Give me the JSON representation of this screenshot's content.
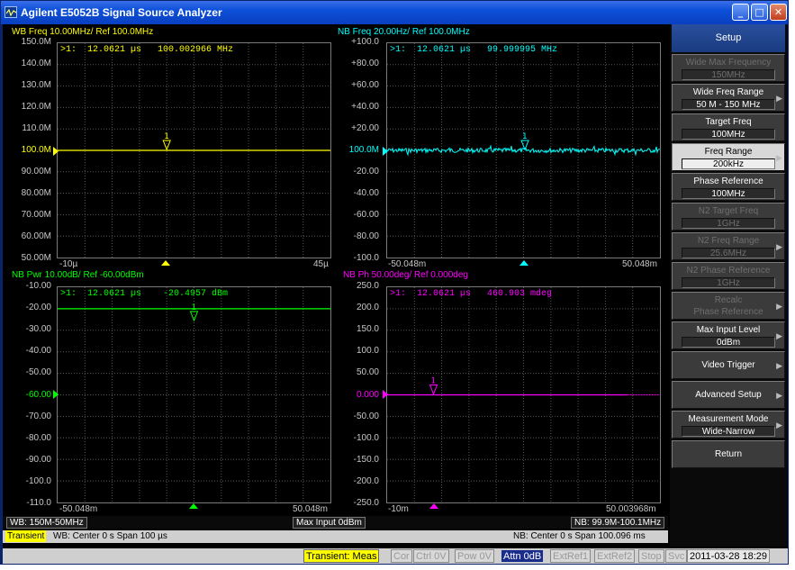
{
  "window": {
    "title": "Agilent E5052B Signal Source Analyzer",
    "min": "_",
    "max": "□",
    "close": "✕"
  },
  "panels": {
    "wb_freq": {
      "title": "WB Freq 10.00MHz/ Ref 100.0MHz",
      "y_labels": [
        "150.0M",
        "140.0M",
        "130.0M",
        "120.0M",
        "110.0M",
        "100.0M",
        "90.00M",
        "80.00M",
        "70.00M",
        "60.00M",
        "50.00M"
      ],
      "marker": ">1:  12.0621 µs   100.002966 MHz",
      "x_start": "-10µ",
      "x_end": "45µ",
      "color": "#ffff00"
    },
    "nb_freq": {
      "title": "NB Freq 20.00Hz/ Ref 100.0MHz",
      "y_labels": [
        "+100.0",
        "+80.00",
        "+60.00",
        "+40.00",
        "+20.00",
        "100.0M",
        "-20.00",
        "-40.00",
        "-60.00",
        "-80.00",
        "-100.0"
      ],
      "marker": ">1:  12.0621 µs   99.999995 MHz",
      "x_start": "-50.048m",
      "x_end": "50.048m",
      "color": "#00ffff"
    },
    "nb_pwr": {
      "title": "NB Pwr 10.00dB/ Ref -60.00dBm",
      "y_labels": [
        "-10.00",
        "-20.00",
        "-30.00",
        "-40.00",
        "-50.00",
        "-60.00",
        "-70.00",
        "-80.00",
        "-90.00",
        "-100.0",
        "-110.0"
      ],
      "marker": ">1:  12.0621 µs    -20.4957 dBm",
      "x_start": "-50.048m",
      "x_end": "50.048m",
      "color": "#00ff00"
    },
    "nb_ph": {
      "title": "NB Ph 50.00deg/ Ref 0.000deg",
      "y_labels": [
        "250.0",
        "200.0",
        "150.0",
        "100.0",
        "50.00",
        "0.000",
        "-50.00",
        "-100.0",
        "-150.0",
        "-200.0",
        "-250.0"
      ],
      "marker": ">1:  12.0621 µs   460.903 mdeg",
      "x_start": "-10m",
      "x_end": "50.003968m",
      "color": "#ff00ff"
    }
  },
  "info": {
    "wb": "WB: 150M-50MHz",
    "max_input": "Max Input 0dBm",
    "nb": "NB: 99.9M-100.1MHz"
  },
  "status": {
    "mode": "Transient",
    "wb_text": "WB: Center 0 s  Span 100 µs",
    "nb_text": "NB: Center 0 s  Span 100.096 ms"
  },
  "softkeys": {
    "header": "Setup",
    "items": [
      {
        "label": "Wide Max Frequency",
        "value": "150MHz",
        "state": "disabled",
        "arrow": ""
      },
      {
        "label": "Wide Freq Range",
        "value": "50 M - 150 MHz",
        "state": "normal",
        "arrow": "▶"
      },
      {
        "label": "Target Freq",
        "value": "100MHz",
        "state": "normal",
        "arrow": ""
      },
      {
        "label": "Freq Range",
        "value": "200kHz",
        "state": "selected",
        "arrow": "▶"
      },
      {
        "label": "Phase Reference",
        "value": "100MHz",
        "state": "normal",
        "arrow": ""
      },
      {
        "label": "N2 Target Freq",
        "value": "1GHz",
        "state": "disabled",
        "arrow": ""
      },
      {
        "label": "N2 Freq Range",
        "value": "25.6MHz",
        "state": "disabled",
        "arrow": "▶"
      },
      {
        "label": "N2 Phase Reference",
        "value": "1GHz",
        "state": "disabled",
        "arrow": ""
      },
      {
        "label": "Recalc",
        "value": "Phase Reference",
        "state": "disabled",
        "arrow": "▶"
      },
      {
        "label": "Max Input Level",
        "value": "0dBm",
        "state": "normal",
        "arrow": "▶"
      },
      {
        "label": "Video Trigger",
        "value": "",
        "state": "normal",
        "arrow": "▶"
      },
      {
        "label": "Advanced Setup",
        "value": "",
        "state": "normal",
        "arrow": "▶"
      },
      {
        "label": "Measurement Mode",
        "value": "Wide-Narrow",
        "state": "normal",
        "arrow": "▶"
      },
      {
        "label": "Return",
        "value": "",
        "state": "normal",
        "arrow": ""
      }
    ]
  },
  "bottom": {
    "transient": "Transient: Meas",
    "cor": "Cor",
    "ctrl": "Ctrl  0V",
    "pow": "Pow  0V",
    "attn": "Attn 0dB",
    "extref1": "ExtRef1",
    "extref2": "ExtRef2",
    "stop": "Stop",
    "svc": "Svc",
    "datetime": "2011-03-28  18:29"
  }
}
